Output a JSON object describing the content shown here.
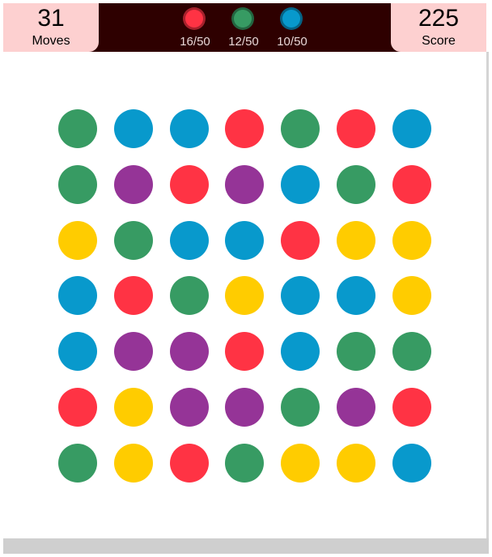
{
  "stats": {
    "moves_value": "31",
    "moves_label": "Moves",
    "score_value": "225",
    "score_label": "Score"
  },
  "goals": [
    {
      "color": "#ff3344",
      "count": "16/50"
    },
    {
      "color": "#379b63",
      "count": "12/50"
    },
    {
      "color": "#0899cc",
      "count": "10/50"
    }
  ],
  "palette": {
    "green": "#379b63",
    "blue": "#0899cc",
    "red": "#ff3344",
    "purple": "#953497",
    "yellow": "#ffcc00"
  },
  "grid": [
    [
      "green",
      "blue",
      "blue",
      "red",
      "green",
      "red",
      "blue"
    ],
    [
      "green",
      "purple",
      "red",
      "purple",
      "blue",
      "green",
      "red"
    ],
    [
      "yellow",
      "green",
      "blue",
      "blue",
      "red",
      "yellow",
      "yellow"
    ],
    [
      "blue",
      "red",
      "green",
      "yellow",
      "blue",
      "blue",
      "yellow"
    ],
    [
      "blue",
      "purple",
      "purple",
      "red",
      "blue",
      "green",
      "green"
    ],
    [
      "red",
      "yellow",
      "purple",
      "purple",
      "green",
      "purple",
      "red"
    ],
    [
      "green",
      "yellow",
      "red",
      "green",
      "yellow",
      "yellow",
      "blue"
    ]
  ],
  "colors": {
    "header_background": "#2e0000",
    "stat_background": "#fdd0d0"
  }
}
